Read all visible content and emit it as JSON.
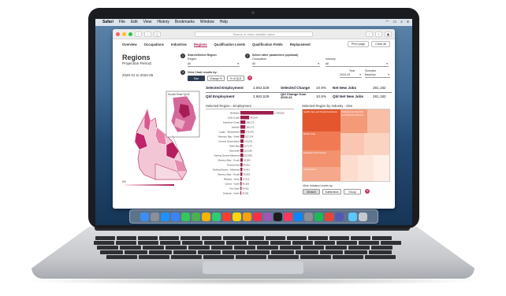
{
  "menubar": {
    "items": [
      "Safari",
      "File",
      "Edit",
      "View",
      "History",
      "Bookmarks",
      "Window",
      "Help"
    ]
  },
  "browser": {
    "url_placeholder": "Search or enter website name"
  },
  "nav": {
    "tabs": [
      "Overview",
      "Occupations",
      "Industries",
      "Regions",
      "Qualification Levels",
      "Qualification Fields",
      "Replacement"
    ],
    "active_index": 3,
    "print_label": "Print page",
    "clear_label": "Clear all"
  },
  "page": {
    "title": "Regions",
    "projection_label": "Projection Period:",
    "period": "2020-21 to 2024-25"
  },
  "controls": {
    "step1": "1",
    "search_region_label": "Search/Select Region",
    "region_label": "Region",
    "region_value": "All",
    "step2": "2",
    "other_params_label": "Select other parameters (optional)",
    "occupation_label": "Occupation",
    "occupation_value": "All",
    "industry_label": "Industry",
    "industry_value": "All",
    "year_label": "Year",
    "year_value": "2024-25",
    "scenario_label": "Scenario",
    "scenario_value": "Baseline",
    "step3": "3",
    "view_chart_label": "View Chart results by:",
    "btn_size": "Size",
    "btn_change": "Change %",
    "btn_pct": "% of QLD"
  },
  "kpis": {
    "sel_emp_label": "Selected Employment",
    "sel_emp_value": "2,862,528",
    "sel_change_label": "Selected Change",
    "sel_change_value": "10.9%",
    "net_new_label": "Net New Jobs",
    "net_new_value": "281,182",
    "qld_emp_label": "Qld Employment",
    "qld_emp_value": "2,862,528",
    "qld_change_label": "Qld Change from 2020-21",
    "qld_change_value": "10.9%",
    "qld_net_label": "Qld Net New Jobs",
    "qld_net_value": "281,182"
  },
  "map": {
    "inset_label": "South East QLD",
    "legend_left": "0%"
  },
  "chart_data": {
    "type": "bar",
    "title": "Selected Region - Employment",
    "categories": [
      "Brisbane",
      "Gold Coast",
      "Sunshine Coast",
      "Ipswich",
      "Logan - Beaudesert",
      "Moreton Bay - North",
      "Central Queensland",
      "Wide Bay",
      "Townsville",
      "Darling Downs-Maranoa",
      "Moreton Bay - South",
      "Toowoomba",
      "Darling Downs - Maranoa",
      "Moreton Bay - South",
      "Mackay - Isaac",
      "Cairns - North",
      "Far North",
      "Outback - North"
    ],
    "values": [
      1293819,
      342547,
      196173,
      192172,
      176233,
      157174,
      123219,
      117174,
      113158,
      113069,
      92834,
      82921,
      76411,
      75633,
      57312,
      45302,
      40411,
      33021
    ],
    "value_labels": [
      "1,293,819",
      "342,547",
      "196,173",
      "192,172",
      "176,233",
      "157,174",
      "123,219",
      "117,174",
      "113,158",
      "113,069",
      "92,834",
      "82,921",
      "76,411",
      "75,633",
      "57,312",
      "45,302",
      "40,411",
      "33,021"
    ]
  },
  "treemap": {
    "title": "Selected Region by Industry - Size",
    "view_label": "View Industry Levels by:",
    "btn_division": "Division",
    "btn_subdivision": "Subdivision",
    "btn_group": "Group",
    "tiles": [
      "Health Care and Social Assistance",
      "Retail Trade",
      "Education and Training",
      "Construction",
      "Professional, Scientific and Technical Services"
    ]
  },
  "dock": {
    "icons": [
      "finder-icon",
      "launchpad-icon",
      "safari-icon",
      "mail-icon",
      "messages-icon",
      "maps-icon",
      "photos-icon",
      "facetime-icon",
      "calendar-icon",
      "notes-icon",
      "reminders-icon",
      "music-icon",
      "podcasts-icon",
      "tv-icon",
      "news-icon",
      "appstore-icon",
      "settings-icon",
      "spotify-icon",
      "chrome-icon",
      "teams-icon",
      "folder-icon",
      "trash-icon"
    ]
  },
  "colors": {
    "accent": "#b1225a",
    "bar": "#9c1f4e",
    "tree_dark": "#e8603f",
    "tree_light": "#fbd8c8"
  }
}
